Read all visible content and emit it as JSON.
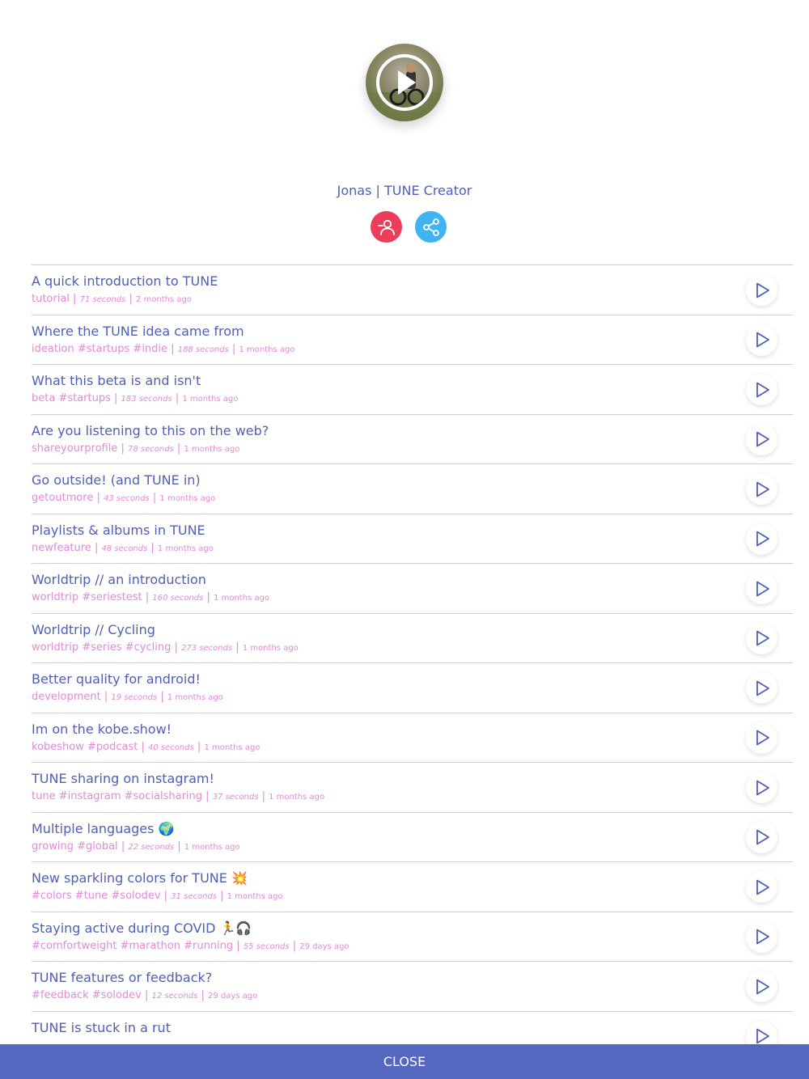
{
  "profile": {
    "name": "Jonas | TUNE Creator",
    "avatar_icon": "play-icon"
  },
  "actions": {
    "unfollow_icon": "person-minus-icon",
    "share_icon": "share-icon"
  },
  "colors": {
    "title": "#4f5fb8",
    "meta": "#e38ad9",
    "unfollow": "#ec3d5b",
    "share": "#3fb4f2",
    "close_bar": "#5468c0"
  },
  "tracks": [
    {
      "title": "A quick introduction to TUNE",
      "tags": "tutorial",
      "duration": "71 seconds",
      "ago": "2 months ago"
    },
    {
      "title": "Where the TUNE idea came from",
      "tags": "ideation #startups #indie",
      "duration": "188 seconds",
      "ago": "1 months ago"
    },
    {
      "title": "What this beta is and isn't",
      "tags": "beta #startups",
      "duration": "183 seconds",
      "ago": "1 months ago"
    },
    {
      "title": "Are you listening to this on the web?",
      "tags": "shareyourprofile",
      "duration": "78 seconds",
      "ago": "1 months ago"
    },
    {
      "title": "Go outside! (and TUNE in)",
      "tags": "getoutmore",
      "duration": "43 seconds",
      "ago": "1 months ago"
    },
    {
      "title": "Playlists & albums in TUNE",
      "tags": "newfeature",
      "duration": "48 seconds",
      "ago": "1 months ago"
    },
    {
      "title": "Worldtrip // an introduction",
      "tags": "worldtrip #seriestest",
      "duration": "160 seconds",
      "ago": "1 months ago"
    },
    {
      "title": "Worldtrip // Cycling",
      "tags": "worldtrip #series #cycling",
      "duration": "273 seconds",
      "ago": "1 months ago"
    },
    {
      "title": "Better quality for android!",
      "tags": "development",
      "duration": "19 seconds",
      "ago": "1 months ago"
    },
    {
      "title": "Im on the kobe.show!",
      "tags": "kobeshow #podcast",
      "duration": "40 seconds",
      "ago": "1 months ago"
    },
    {
      "title": "TUNE sharing on instagram!",
      "tags": "tune #instagram #socialsharing",
      "duration": "37 seconds",
      "ago": "1 months ago"
    },
    {
      "title": "Multiple languages 🌍",
      "tags": "growing #global",
      "duration": "22 seconds",
      "ago": "1 months ago"
    },
    {
      "title": "New sparkling colors for TUNE 💥",
      "tags": "#colors #tune #solodev",
      "duration": "31 seconds",
      "ago": "1 months ago"
    },
    {
      "title": "Staying active during COVID 🏃🎧",
      "tags": "#comfortweight #marathon #running",
      "duration": "55 seconds",
      "ago": "29 days ago"
    },
    {
      "title": "TUNE features or feedback?",
      "tags": "#feedback #solodev",
      "duration": "12 seconds",
      "ago": "29 days ago"
    },
    {
      "title": "TUNE is stuck in a rut",
      "tags": "",
      "duration": "",
      "ago": ""
    }
  ],
  "footer": {
    "close_label": "CLOSE"
  }
}
